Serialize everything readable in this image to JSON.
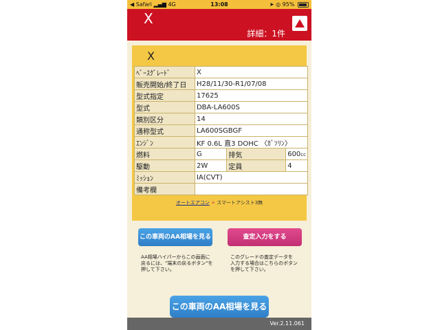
{
  "status_bar": {
    "carrier": "◀ Safari",
    "network": "4G",
    "time": "13:08",
    "battery": "95%"
  },
  "header": {
    "title": "X",
    "detail": "詳細：1件"
  },
  "card": {
    "title": "X",
    "rows": [
      {
        "label": "ﾍﾞｰｽｸﾞﾚｰﾄﾞ",
        "value": "X"
      },
      {
        "label": "販売開始/終了日",
        "value": "H28/11/30-R1/07/08"
      },
      {
        "label": "型式指定",
        "value": "17625"
      },
      {
        "label": "型式",
        "value": "DBA-LA600S"
      },
      {
        "label": "類別区分",
        "value": "14"
      },
      {
        "label": "通称型式",
        "value": "LA600SGBGF"
      },
      {
        "label": "ｴﾝｼﾞﾝ",
        "value": "KF 0.6L 直3 DOHC 〈ｶﾞｿﾘﾝ〉"
      }
    ],
    "fuel": {
      "label": "燃料",
      "value": "G",
      "label2": "排気",
      "value2": "600",
      "unit2": "cc"
    },
    "drive": {
      "label": "駆動",
      "value": "2W",
      "label2": "定員",
      "value2": "4"
    },
    "mission": {
      "label": "ﾐｯｼｮﾝ",
      "value": "IA(CVT)"
    },
    "remarks": {
      "label": "備考欄",
      "value": ""
    },
    "note_link": "オートエアコン",
    "note_plus": "+",
    "note_rest": "スマートアシスト3無"
  },
  "buttons": {
    "aa_market": "この車両のAA相場を見る",
    "appraisal": "査定入力をする",
    "aa_market_big": "この車両のAA相場を見る"
  },
  "desc_left": [
    "AA相場ハイパーからこの画面に",
    "戻るには、\"端末の戻るボタン\"を",
    "押して下さい。"
  ],
  "desc_right": [
    "このグレードの査定データを",
    "入力する場合はこちらのボタン",
    "を押して下さい。"
  ],
  "footer": {
    "version": "Ver.2.11.061"
  },
  "colors": {
    "header": "#cc1122",
    "card": "#f4c845",
    "blue_button": "#3a8fd8",
    "pink_button": "#d63c82"
  }
}
